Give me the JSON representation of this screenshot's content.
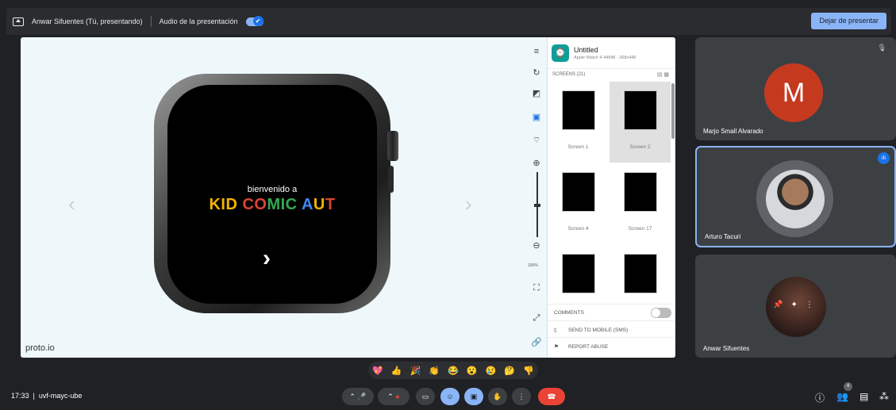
{
  "topbar": {
    "presenter": "Anwar Sifuentes (Tú, presentando)",
    "audio_label": "Audio de la presentación",
    "stop_button": "Dejar de presentar"
  },
  "presentation": {
    "watch_welcome": "bienvenido a",
    "watch_title_parts": [
      "KID",
      " CO",
      "MIC",
      " A",
      "U",
      "T"
    ],
    "watch_next": "›",
    "prev_arrow": "‹",
    "next_arrow": "›",
    "brand": "proto.io",
    "toolbar": {
      "zoom_percent": "100%"
    },
    "panel": {
      "project_title": "Untitled",
      "project_subtitle": "Apple Watch 4 44MM - 368x448",
      "screens_label": "SCREENS (21)",
      "screens": [
        {
          "label": "Screen 1"
        },
        {
          "label": "Screen 2"
        },
        {
          "label": "Screen 4"
        },
        {
          "label": "Screen 17"
        }
      ],
      "comments_label": "COMMENTS",
      "send_mobile_label": "SEND TO MOBILE (SMS)",
      "report_label": "REPORT ABUSE"
    }
  },
  "participants": [
    {
      "name": "Marjo Small Alvarado",
      "initial": "M",
      "avatar_color": "#c5391f"
    },
    {
      "name": "Arturo Tacuri"
    },
    {
      "name": "Anwar Sifuentes"
    }
  ],
  "reactions": [
    "💖",
    "👍",
    "🎉",
    "👏",
    "😂",
    "😮",
    "😢",
    "🤔",
    "👎"
  ],
  "bottombar": {
    "time": "17:33",
    "meeting_code": "uvf-mayc-ube",
    "people_count": "4"
  }
}
